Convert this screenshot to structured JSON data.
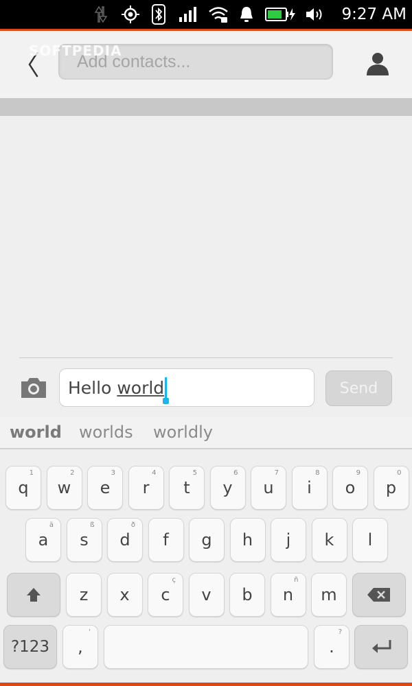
{
  "status": {
    "time": "9:27 AM"
  },
  "header": {
    "contacts_placeholder": "Add contacts...",
    "watermark": "SOFTPEDIA"
  },
  "composer": {
    "text_before": "Hello ",
    "text_current_word": "world",
    "send_label": "Send"
  },
  "suggestions": [
    "world",
    "worlds",
    "worldly"
  ],
  "keyboard": {
    "row1": [
      {
        "k": "q",
        "s": "1"
      },
      {
        "k": "w",
        "s": "2"
      },
      {
        "k": "e",
        "s": "3"
      },
      {
        "k": "r",
        "s": "4"
      },
      {
        "k": "t",
        "s": "5"
      },
      {
        "k": "y",
        "s": "6"
      },
      {
        "k": "u",
        "s": "7"
      },
      {
        "k": "i",
        "s": "8"
      },
      {
        "k": "o",
        "s": "9"
      },
      {
        "k": "p",
        "s": "0"
      }
    ],
    "row2": [
      {
        "k": "a",
        "s": "ä"
      },
      {
        "k": "s",
        "s": "ß"
      },
      {
        "k": "d",
        "s": "ð"
      },
      {
        "k": "f",
        "s": ""
      },
      {
        "k": "g",
        "s": ""
      },
      {
        "k": "h",
        "s": ""
      },
      {
        "k": "j",
        "s": ""
      },
      {
        "k": "k",
        "s": ""
      },
      {
        "k": "l",
        "s": ""
      }
    ],
    "row3": [
      {
        "k": "z",
        "s": ""
      },
      {
        "k": "x",
        "s": ""
      },
      {
        "k": "c",
        "s": "ç"
      },
      {
        "k": "v",
        "s": ""
      },
      {
        "k": "b",
        "s": ""
      },
      {
        "k": "n",
        "s": "ñ"
      },
      {
        "k": "m",
        "s": ""
      }
    ],
    "symbols_label": "?123",
    "comma_label": ",",
    "comma_sub": "'",
    "period_label": ".",
    "period_sub": "?"
  }
}
